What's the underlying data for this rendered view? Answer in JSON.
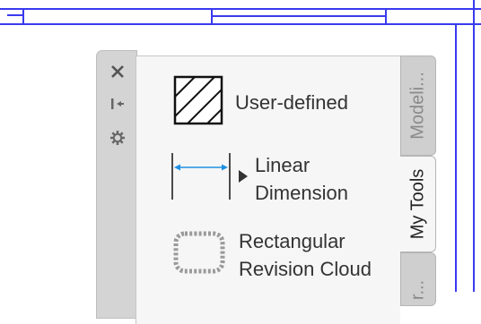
{
  "palette": {
    "title_icons": [
      "close-icon",
      "autohide-icon",
      "properties-icon"
    ],
    "tools": [
      {
        "label_lines": [
          "User-defined"
        ],
        "icon": "hatch-icon"
      },
      {
        "label_lines": [
          "Linear",
          "Dimension"
        ],
        "icon": "linear-dimension-icon"
      },
      {
        "label_lines": [
          "Rectangular",
          "Revision Cloud"
        ],
        "icon": "revision-cloud-icon"
      }
    ],
    "tabs": [
      {
        "label": "Modeli...",
        "active": false
      },
      {
        "label": "My Tools",
        "active": true
      },
      {
        "label": "r...",
        "active": false
      }
    ]
  },
  "colors": {
    "drawing_lines": "#3a3af0",
    "dimension_arrow": "#1e90e0"
  }
}
